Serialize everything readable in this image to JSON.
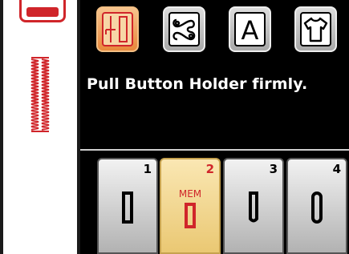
{
  "message": "Pull Button Holder firmly.",
  "mode_buttons": [
    {
      "name": "utility-stitch",
      "icon": "buttonhole-stitch-icon",
      "active": true
    },
    {
      "name": "decorative-stitch",
      "icon": "decorative-stitch-icon",
      "active": false
    },
    {
      "name": "letters",
      "icon": "letter-a-icon",
      "label": "A",
      "active": false
    },
    {
      "name": "clothing",
      "icon": "shirt-icon",
      "active": false
    }
  ],
  "memory_slots": [
    {
      "number": "1",
      "label": "",
      "active": false
    },
    {
      "number": "2",
      "label": "MEM",
      "active": true
    },
    {
      "number": "3",
      "label": "",
      "active": false
    },
    {
      "number": "4",
      "label": "",
      "active": false
    }
  ],
  "colors": {
    "accent_red": "#d0252a",
    "active_orange": "#e8883b",
    "active_slot": "#eac873",
    "background": "#000000"
  }
}
